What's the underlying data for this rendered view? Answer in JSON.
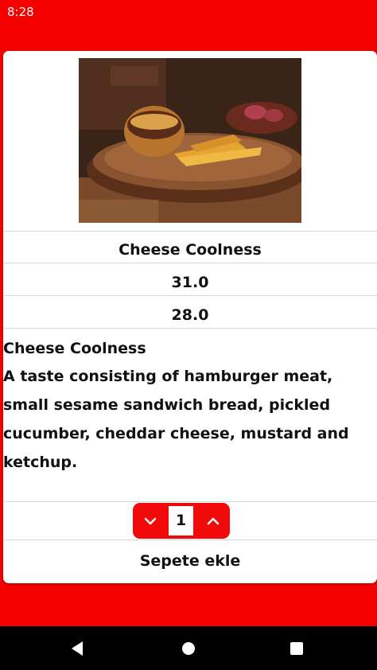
{
  "status_bar": {
    "time": "8:28"
  },
  "product": {
    "image_icon": "burger-fries-photo",
    "name": "Cheese Coolness",
    "price": "31.0",
    "discount_price": "28.0",
    "description_title": "Cheese Coolness",
    "description": "A taste consisting of hamburger meat, small sesame sandwich bread, pickled cucumber, cheddar cheese, mustard and ketchup."
  },
  "quantity": {
    "value": "1",
    "decrease_icon": "chevron-down-icon",
    "increase_icon": "chevron-up-icon"
  },
  "actions": {
    "add_to_cart_label": "Sepete ekle"
  },
  "navigation": {
    "back_icon": "back-triangle-icon",
    "home_icon": "home-circle-icon",
    "recents_icon": "recents-square-icon"
  },
  "colors": {
    "accent": "#f50000",
    "stepper": "#f20a0a",
    "nav_bar": "#000000",
    "card": "#ffffff"
  }
}
